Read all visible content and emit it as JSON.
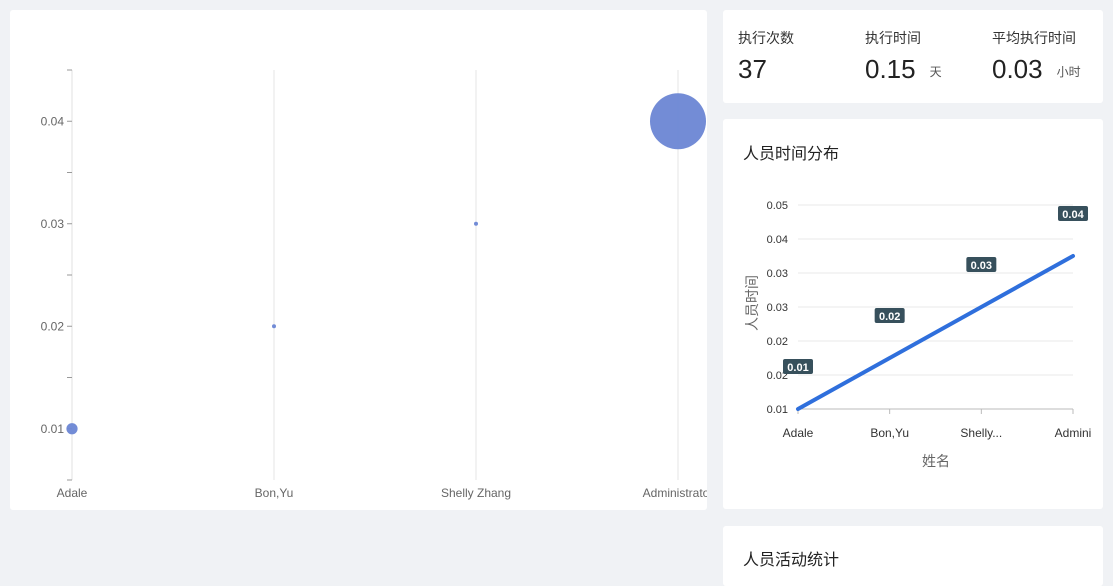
{
  "stats": [
    {
      "label": "执行次数",
      "value": "37",
      "unit": ""
    },
    {
      "label": "执行时间",
      "value": "0.15",
      "unit": "天"
    },
    {
      "label": "平均执行时间",
      "value": "0.03",
      "unit": "小时"
    }
  ],
  "line_panel": {
    "title": "人员时间分布"
  },
  "activity_panel": {
    "title": "人员活动统计"
  },
  "chart_data": [
    {
      "type": "scatter",
      "categories": [
        "Adale",
        "Bon,Yu",
        "Shelly Zhang",
        "Administrator"
      ],
      "values": [
        0.01,
        0.02,
        0.03,
        0.04
      ],
      "bubble_size_relative": [
        0.2,
        0.05,
        0.05,
        1.0
      ],
      "ytick_labels": [
        "0.01",
        "0.02",
        "0.03",
        "0.04"
      ],
      "ylim": [
        0.005,
        0.045
      ],
      "color": "#6b86d4",
      "grid": "vertical"
    },
    {
      "type": "line",
      "categories": [
        "Adale",
        "Bon,Yu",
        "Shelly...",
        "Admini"
      ],
      "values": [
        0.01,
        0.02,
        0.03,
        0.04
      ],
      "data_labels": [
        "0.01",
        "0.02",
        "0.03",
        "0.04"
      ],
      "ytick_labels": [
        "0.01",
        "0.02",
        "0.02",
        "0.03",
        "0.03",
        "0.04",
        "0.05"
      ],
      "ylim": [
        0.01,
        0.05
      ],
      "xlabel": "姓名",
      "ylabel": "人员时间",
      "color": "#2f6fdc",
      "label_bg": "#37505c",
      "grid": "horizontal"
    }
  ]
}
